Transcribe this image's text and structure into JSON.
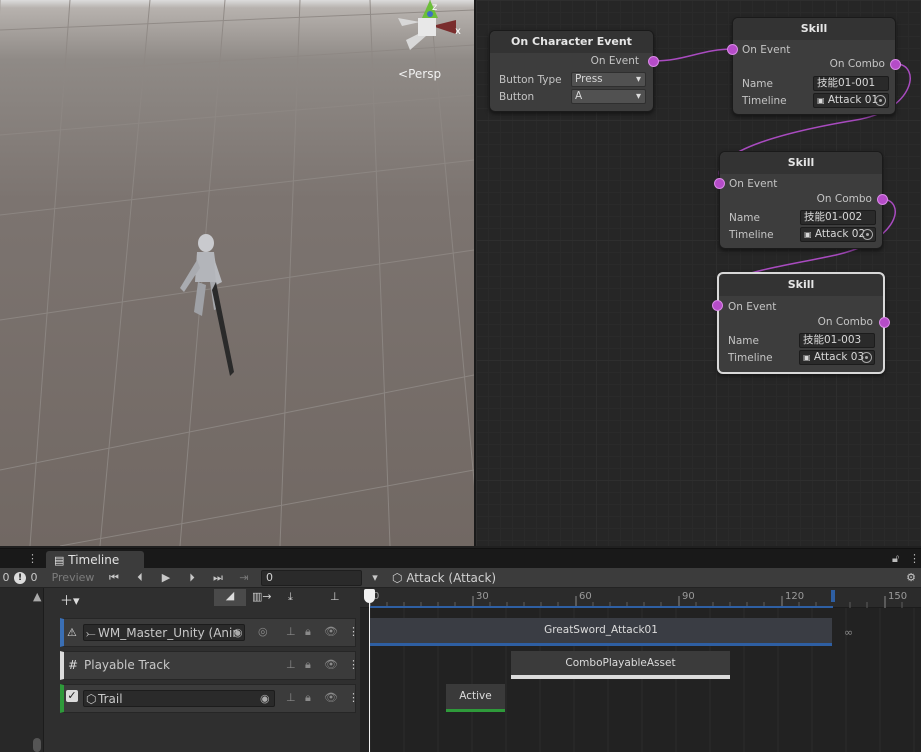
{
  "scene": {
    "view_mode": "Persp",
    "gizmo_axes": {
      "x": "x",
      "z": "z"
    }
  },
  "graph": {
    "event_node": {
      "title": "On Character Event",
      "output_port": "On Event",
      "button_type_label": "Button Type",
      "button_type_value": "Press",
      "button_label": "Button",
      "button_value": "A"
    },
    "skill_nodes": [
      {
        "title": "Skill",
        "input_port": "On Event",
        "output_port": "On Combo",
        "name_label": "Name",
        "name_value": "技能01-001",
        "timeline_label": "Timeline",
        "timeline_value": "Attack 01"
      },
      {
        "title": "Skill",
        "input_port": "On Event",
        "output_port": "On Combo",
        "name_label": "Name",
        "name_value": "技能01-002",
        "timeline_label": "Timeline",
        "timeline_value": "Attack 02"
      },
      {
        "title": "Skill",
        "input_port": "On Event",
        "output_port": "On Combo",
        "name_label": "Name",
        "name_value": "技能01-003",
        "timeline_label": "Timeline",
        "timeline_value": "Attack 03"
      }
    ],
    "port_color": "#b54cc8"
  },
  "timeline": {
    "tab_label": "Timeline",
    "preview_label": "Preview",
    "frame_value": "0",
    "left_counter_a": "0",
    "left_counter_b": "0",
    "breadcrumb": "Attack (Attack)",
    "ruler_labels": [
      "0",
      "30",
      "60",
      "90",
      "120",
      "150"
    ],
    "tracks": [
      {
        "name": "WM_Master_Unity (Anir",
        "color": "#3a6fb5"
      },
      {
        "name": "Playable Track",
        "color": "#dcdcdc"
      },
      {
        "name": "Trail",
        "color": "#2e9a3a"
      }
    ],
    "clips": [
      {
        "label": "GreatSword_Attack01"
      },
      {
        "label": "ComboPlayableAsset"
      },
      {
        "label": "Active"
      }
    ]
  }
}
